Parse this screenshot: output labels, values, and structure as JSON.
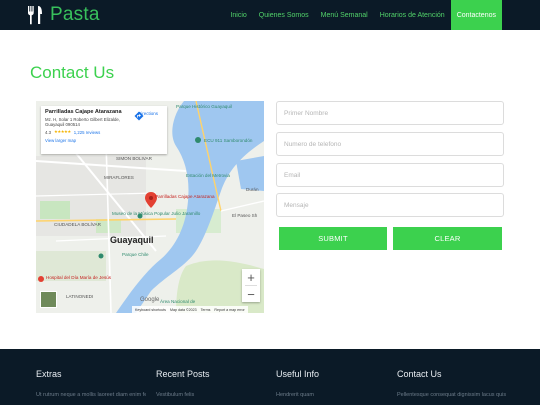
{
  "brand": {
    "name": "Pasta",
    "accent": "#3cd14e",
    "header_bg": "#0b1a27"
  },
  "nav": {
    "items": [
      {
        "label": "Inicio"
      },
      {
        "label": "Quienes Somos"
      },
      {
        "label": "Menú Semanal"
      },
      {
        "label": "Horarios de Atención"
      },
      {
        "label": "Contactenos",
        "active": true
      }
    ]
  },
  "page": {
    "title": "Contact Us"
  },
  "map": {
    "place_name": "Parrilladas Cajape Atarazana",
    "address": "Mz. H, Solar 1 Roberto Gilbert Elizalde, Guayaquil 090514",
    "rating": "4.3",
    "stars": "★★★★★",
    "reviews": "1,225 reviews",
    "larger_map": "View larger map",
    "directions": "Directions",
    "zoom_in": "+",
    "zoom_out": "−",
    "labels": {
      "park_history": "Parque Histórico Guayaquil",
      "ecu911": "ECU 911 Samborondón",
      "simon_bolivar": "SIMON BOLIVAR",
      "miraflores": "MIRAFLORES",
      "ciudadela_bolivar": "CIUDADELA BOLÍVAR",
      "estacion": "Estación del Metrovia",
      "cajape_pin": "Parrilladas Cajape Atarazana",
      "duran": "Durán",
      "museo": "Museo de la Música Popular Julio Jaramillo",
      "el_paseo": "El Paseo Sh",
      "guayaquil": "Guayaquil",
      "parque_chile": "Parque Chile",
      "hospital": "Hospital del Día María de Jesús",
      "area_nacional": "Área Nacional de",
      "cisne": "CISNE",
      "latinonedi": "LATINONEDI",
      "bellavista": "BELLAVISTA"
    },
    "footer": {
      "google": "Google",
      "shortcuts": "Keyboard shortcuts",
      "mapdata": "Map data ©2023",
      "terms": "Terms",
      "report": "Report a map error"
    }
  },
  "form": {
    "name_placeholder": "Primer Nombre",
    "phone_placeholder": "Numero de telefono",
    "email_placeholder": "Email",
    "message_placeholder": "Mensaje",
    "submit_label": "SUBMIT",
    "clear_label": "CLEAR"
  },
  "footer": {
    "columns": [
      {
        "heading": "Extras",
        "text": "Ut rutrum neque a mollis laoreet diam enim feugiat dui nec ultricies"
      },
      {
        "heading": "Recent Posts",
        "text": "Vestibulum felis"
      },
      {
        "heading": "Useful Info",
        "text": "Hendrerit quam"
      },
      {
        "heading": "Contact Us",
        "text": "Pellentesque consequat dignissim lacus quis aliquam"
      }
    ]
  }
}
